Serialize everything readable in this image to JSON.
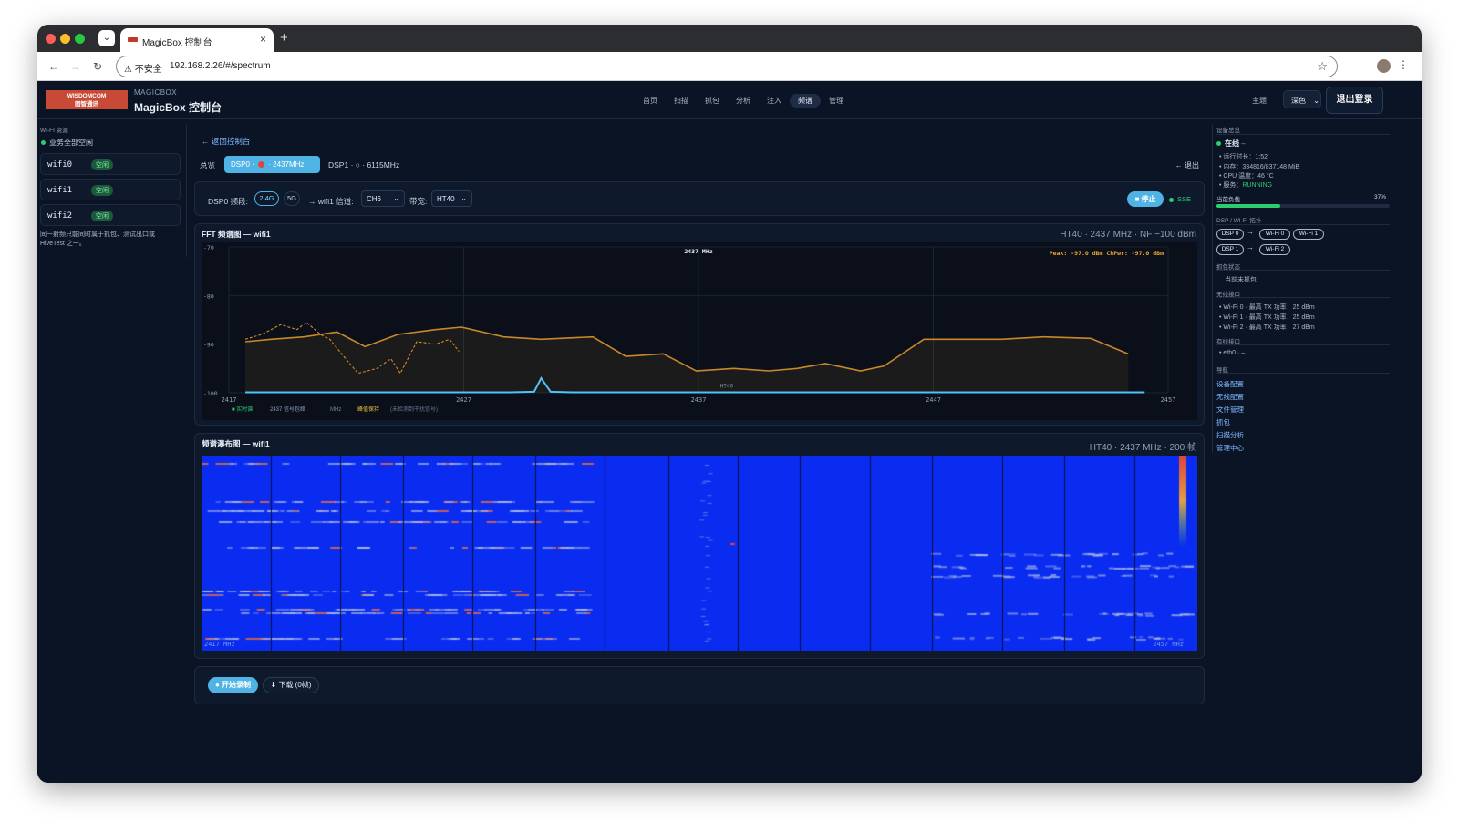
{
  "browser": {
    "tab_title": "MagicBox 控制台",
    "security": "不安全",
    "url": "192.168.2.26/#/spectrum"
  },
  "header": {
    "logo_line1": "WISDOMCOM",
    "logo_line2": "图智通讯",
    "brand_small": "MAGICBOX",
    "brand_title": "MagicBox 控制台",
    "nav": [
      "首页",
      "扫描",
      "抓包",
      "分析",
      "注入",
      "频谱",
      "管理"
    ],
    "nav_active": 5,
    "theme_label": "主题",
    "theme_value": "深色",
    "logout_label": "退出登录"
  },
  "left_sidebar": {
    "heading": "WI-FI 资源",
    "status": "业务全部空闲",
    "interfaces": [
      {
        "name": "wifi0",
        "badge": "空闲"
      },
      {
        "name": "wifi1",
        "badge": "空闲"
      },
      {
        "name": "wifi2",
        "badge": "空闲"
      }
    ],
    "note": "同一射频只能同时属于抓包、测试出口或 HiveTest 之一。"
  },
  "main": {
    "back_link": "← 返回控制台",
    "tab_overview": "总览",
    "tab_dsp0_a": "DSP0 ·",
    "tab_dsp0_b": "· 2437MHz",
    "tab_dsp1": "DSP1 · ○ · 6115MHz",
    "exit_label": "← 退出",
    "controls": {
      "band_label": "DSP0 频段:",
      "band_24": "2.4G",
      "band_5": "5G",
      "iface_label": "→ wifi1 信道:",
      "channel": "CH6",
      "bw_label": "带宽:",
      "bandwidth": "HT40",
      "stop_label": "■ 停止",
      "sse_label": "SSE"
    },
    "fft": {
      "title": "FFT 频谱图 — wifi1",
      "info": "HT40 · 2437 MHz · NF −100 dBm"
    },
    "waterfall": {
      "title": "频谱瀑布图 — wifi1",
      "info": "HT40 · 2437 MHz · 200 帧",
      "left_label": "2417 MHz",
      "right_label": "2457 MHz"
    },
    "record_label": "● 开始录制",
    "download_label": "⬇ 下载 (0帧)"
  },
  "chart_data": {
    "type": "line",
    "title": "",
    "center_label": "2437 MHz",
    "peak_label": "Peak: -97.0 dBm  ChPwr: -97.0 dBm",
    "band_label": "HT40",
    "xlim": [
      2417,
      2457
    ],
    "ylim": [
      -100,
      -70
    ],
    "x_ticks": [
      2417,
      2427,
      2437,
      2447,
      2457
    ],
    "y_ticks": [
      -70,
      -80,
      -90,
      -100
    ],
    "legend": [
      "■ 实时谱",
      "2437 信号包络",
      "MHz",
      "峰值保持",
      "(未检测到干扰信号)"
    ],
    "series": [
      {
        "name": "峰值保持",
        "x": [
          2417.7,
          2418.8,
          2420.2,
          2421.6,
          2422.8,
          2424.2,
          2425.8,
          2426.9,
          2428.7,
          2430.3,
          2432.5,
          2433.9,
          2435.5,
          2436.9,
          2438.5,
          2440.0,
          2441.2,
          2442.4,
          2443.9,
          2444.9,
          2446.6,
          2447.9,
          2449.9,
          2451.7,
          2453.7,
          2455.3
        ],
        "y": [
          -89.5,
          -89.0,
          -88.5,
          -87.5,
          -90.5,
          -88.0,
          -87.0,
          -86.5,
          -88.5,
          -89.0,
          -88.5,
          -92.5,
          -92.0,
          -95.5,
          -95.0,
          -95.5,
          -95.0,
          -94.0,
          -95.5,
          -94.5,
          -89.0,
          -89.0,
          -89.0,
          -88.5,
          -88.8,
          -92.0
        ]
      },
      {
        "name": "实时谱",
        "x": [
          2417.7,
          2418.4,
          2419.2,
          2419.9,
          2420.3,
          2420.9,
          2421.3,
          2421.8,
          2422.5,
          2423.3,
          2423.9,
          2424.3,
          2425.0,
          2425.8,
          2426.4,
          2426.8
        ],
        "y": [
          -89.0,
          -88.0,
          -86.0,
          -87.0,
          -85.5,
          -88.0,
          -89.0,
          -92.0,
          -96.0,
          -95.0,
          -93.0,
          -96.0,
          -89.5,
          -90.0,
          -89.0,
          -91.5
        ]
      },
      {
        "name": "2437 信号包络",
        "x": [
          2417.7,
          2429.0,
          2430.0,
          2430.3,
          2430.7,
          2431.6,
          2456.0
        ],
        "y": [
          -99.9,
          -99.9,
          -99.8,
          -97.0,
          -99.8,
          -99.9,
          -99.9
        ]
      }
    ]
  },
  "right_sidebar": {
    "overview_heading": "设备总览",
    "online": "在线",
    "online_suffix": "–",
    "uptime": "运行时长：1:52",
    "memory": "内存：334816/837148 MiB",
    "cpu_temp": "CPU 温度：46 °C",
    "service_label": "服务：",
    "service_value": "RUNNING",
    "load_label": "当前负载",
    "load_value": "37%",
    "load_fraction": 0.37,
    "topology_heading": "DSP / WI-FI 拓扑",
    "topo_row1": [
      "DSP 0",
      "Wi-Fi 0",
      "Wi-Fi 1"
    ],
    "topo_row2": [
      "DSP 1",
      "Wi-Fi 2"
    ],
    "capture_heading": "抓包状态",
    "capture_text": "当前未抓包",
    "wireless_heading": "无线接口",
    "wireless_items": [
      "Wi-Fi 0 · 最高 TX 功率：25 dBm",
      "Wi-Fi 1 · 最高 TX 功率：25 dBm",
      "Wi-Fi 2 · 最高 TX 功率：27 dBm"
    ],
    "wired_heading": "有线接口",
    "wired_items": [
      "eth0 · –"
    ],
    "nav_heading": "导航",
    "nav_links": [
      "设备配置",
      "无线配置",
      "文件管理",
      "抓包",
      "扫描分析",
      "管理中心"
    ]
  },
  "colors": {
    "background": "#0b1424",
    "accent": "#4fb3e6",
    "peak_hold": "#c8882a",
    "live": "#d58a2c",
    "envelope": "#4fc3f7",
    "waterfall_bg": "#0a2cf0"
  }
}
